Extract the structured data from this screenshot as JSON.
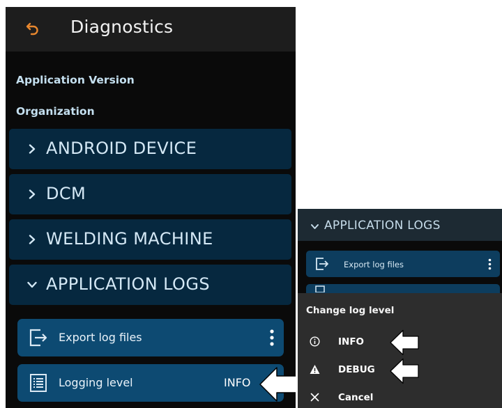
{
  "header": {
    "title": "Diagnostics",
    "back_icon": "back-arrow-icon"
  },
  "info": {
    "app_version_label": "Application Version",
    "organization_label": "Organization"
  },
  "sections": [
    {
      "label": "ANDROID DEVICE",
      "expanded": false
    },
    {
      "label": "DCM",
      "expanded": false
    },
    {
      "label": "WELDING MACHINE",
      "expanded": false
    },
    {
      "label": "APPLICATION LOGS",
      "expanded": true
    }
  ],
  "logs": {
    "export_label": "Export log files",
    "logging_label": "Logging level",
    "logging_value": "INFO"
  },
  "inset": {
    "section_label": "APPLICATION LOGS",
    "export_label": "Export log files",
    "sheet": {
      "title": "Change log level",
      "options": [
        {
          "label": "INFO",
          "icon": "info-icon"
        },
        {
          "label": "DEBUG",
          "icon": "warning-icon"
        },
        {
          "label": "Cancel",
          "icon": "close-icon"
        }
      ]
    }
  },
  "colors": {
    "accent_orange": "#e8872e",
    "section_bg": "#06283f",
    "row_bg": "#0d4a72",
    "sheet_bg": "#2d2d2d"
  }
}
